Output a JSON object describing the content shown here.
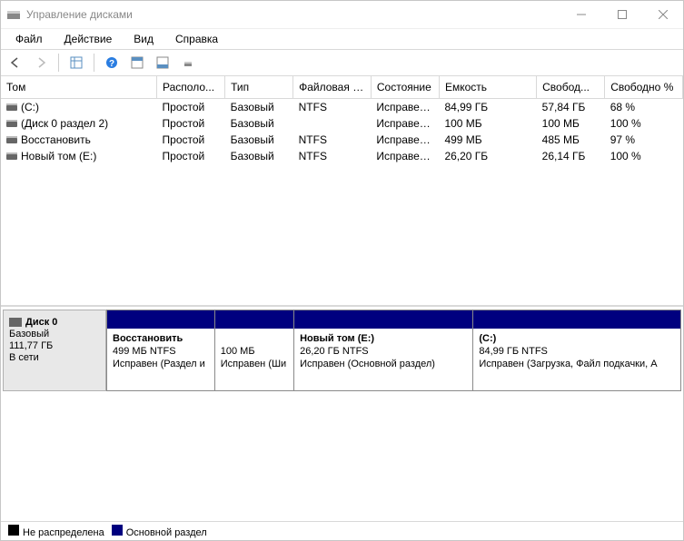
{
  "window": {
    "title": "Управление дисками"
  },
  "menu": {
    "file": "Файл",
    "action": "Действие",
    "view": "Вид",
    "help": "Справка"
  },
  "columns": {
    "volume": "Том",
    "layout": "Располо...",
    "type": "Тип",
    "filesystem": "Файловая с...",
    "status": "Состояние",
    "capacity": "Емкость",
    "free": "Свобод...",
    "free_pct": "Свободно %"
  },
  "volumes": [
    {
      "name": "(C:)",
      "layout": "Простой",
      "type": "Базовый",
      "fs": "NTFS",
      "status": "Исправен...",
      "capacity": "84,99 ГБ",
      "free": "57,84 ГБ",
      "free_pct": "68 %"
    },
    {
      "name": "(Диск 0 раздел 2)",
      "layout": "Простой",
      "type": "Базовый",
      "fs": "",
      "status": "Исправен...",
      "capacity": "100 МБ",
      "free": "100 МБ",
      "free_pct": "100 %"
    },
    {
      "name": "Восстановить",
      "layout": "Простой",
      "type": "Базовый",
      "fs": "NTFS",
      "status": "Исправен...",
      "capacity": "499 МБ",
      "free": "485 МБ",
      "free_pct": "97 %"
    },
    {
      "name": "Новый том (E:)",
      "layout": "Простой",
      "type": "Базовый",
      "fs": "NTFS",
      "status": "Исправен...",
      "capacity": "26,20 ГБ",
      "free": "26,14 ГБ",
      "free_pct": "100 %"
    }
  ],
  "disk": {
    "name": "Диск 0",
    "type": "Базовый",
    "size": "111,77 ГБ",
    "status": "В сети",
    "partitions": [
      {
        "title": "Восстановить",
        "size": "499 МБ NTFS",
        "status": "Исправен (Раздел и",
        "flex": 15
      },
      {
        "title": "",
        "size": "100 МБ",
        "status": "Исправен (Ши",
        "flex": 11
      },
      {
        "title": "Новый том  (E:)",
        "size": "26,20 ГБ NTFS",
        "status": "Исправен (Основной раздел)",
        "flex": 25
      },
      {
        "title": "(C:)",
        "size": "84,99 ГБ NTFS",
        "status": "Исправен (Загрузка, Файл подкачки, А",
        "flex": 29
      }
    ]
  },
  "legend": {
    "unallocated": "Не распределена",
    "primary": "Основной раздел"
  }
}
